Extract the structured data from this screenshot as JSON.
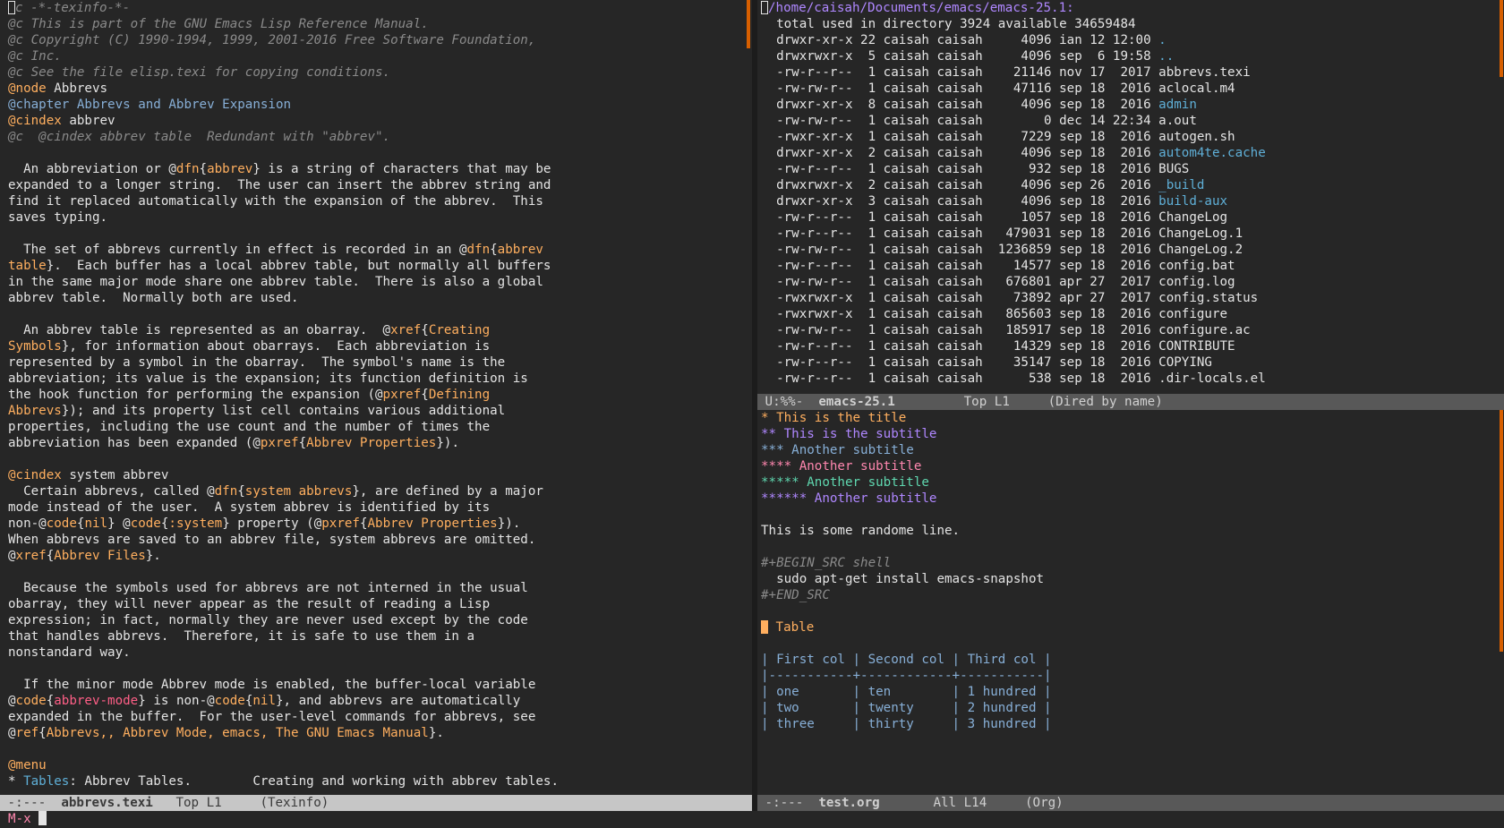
{
  "left": {
    "lines": [
      [
        {
          "t": "@c -*-texinfo-*-",
          "c": "comment",
          "cursor": true
        }
      ],
      [
        {
          "t": "@c This is part of the GNU Emacs Lisp Reference Manual.",
          "c": "comment"
        }
      ],
      [
        {
          "t": "@c Copyright (C) 1990-1994, 1999, 2001-2016 Free Software Foundation,",
          "c": "comment"
        }
      ],
      [
        {
          "t": "@c Inc.",
          "c": "comment"
        }
      ],
      [
        {
          "t": "@c See the file elisp.texi for copying conditions.",
          "c": "comment"
        }
      ],
      [
        {
          "t": "@",
          "c": "at"
        },
        {
          "t": "node",
          "c": "cmd"
        },
        {
          "t": " Abbrevs",
          "c": "plain"
        }
      ],
      [
        {
          "t": "@chapter Abbrevs and Abbrev Expansion",
          "c": "chap"
        }
      ],
      [
        {
          "t": "@",
          "c": "at"
        },
        {
          "t": "cindex",
          "c": "cmd"
        },
        {
          "t": " abbrev",
          "c": "plain"
        }
      ],
      [
        {
          "t": "@c  @cindex abbrev table  Redundant with \"abbrev\".",
          "c": "comment"
        }
      ],
      [
        {
          "t": "",
          "c": "plain"
        }
      ],
      [
        {
          "t": "  An abbreviation or @",
          "c": "plain"
        },
        {
          "t": "dfn",
          "c": "cmd"
        },
        {
          "t": "{",
          "c": "plain"
        },
        {
          "t": "abbrev",
          "c": "arg"
        },
        {
          "t": "} is a string of characters that may be",
          "c": "plain"
        }
      ],
      [
        {
          "t": "expanded to a longer string.  The user can insert the abbrev string and",
          "c": "plain"
        }
      ],
      [
        {
          "t": "find it replaced automatically with the expansion of the abbrev.  This",
          "c": "plain"
        }
      ],
      [
        {
          "t": "saves typing.",
          "c": "plain"
        }
      ],
      [
        {
          "t": "",
          "c": "plain"
        }
      ],
      [
        {
          "t": "  The set of abbrevs currently in effect is recorded in an @",
          "c": "plain"
        },
        {
          "t": "dfn",
          "c": "cmd"
        },
        {
          "t": "{",
          "c": "plain"
        },
        {
          "t": "abbrev",
          "c": "arg"
        }
      ],
      [
        {
          "t": "table",
          "c": "arg"
        },
        {
          "t": "}.  Each buffer has a local abbrev table, but normally all buffers",
          "c": "plain"
        }
      ],
      [
        {
          "t": "in the same major mode share one abbrev table.  There is also a global",
          "c": "plain"
        }
      ],
      [
        {
          "t": "abbrev table.  Normally both are used.",
          "c": "plain"
        }
      ],
      [
        {
          "t": "",
          "c": "plain"
        }
      ],
      [
        {
          "t": "  An abbrev table is represented as an obarray.  @",
          "c": "plain"
        },
        {
          "t": "xref",
          "c": "cmd"
        },
        {
          "t": "{",
          "c": "plain"
        },
        {
          "t": "Creating",
          "c": "arg"
        }
      ],
      [
        {
          "t": "Symbols",
          "c": "arg"
        },
        {
          "t": "}, for information about obarrays.  Each abbreviation is",
          "c": "plain"
        }
      ],
      [
        {
          "t": "represented by a symbol in the obarray.  The symbol's name is the",
          "c": "plain"
        }
      ],
      [
        {
          "t": "abbreviation; its value is the expansion; its function definition is",
          "c": "plain"
        }
      ],
      [
        {
          "t": "the hook function for performing the expansion (@",
          "c": "plain"
        },
        {
          "t": "pxref",
          "c": "cmd"
        },
        {
          "t": "{",
          "c": "plain"
        },
        {
          "t": "Defining",
          "c": "arg"
        }
      ],
      [
        {
          "t": "Abbrevs",
          "c": "arg"
        },
        {
          "t": "}); and its property list cell contains various additional",
          "c": "plain"
        }
      ],
      [
        {
          "t": "properties, including the use count and the number of times the",
          "c": "plain"
        }
      ],
      [
        {
          "t": "abbreviation has been expanded (@",
          "c": "plain"
        },
        {
          "t": "pxref",
          "c": "cmd"
        },
        {
          "t": "{",
          "c": "plain"
        },
        {
          "t": "Abbrev Properties",
          "c": "arg"
        },
        {
          "t": "}).",
          "c": "plain"
        }
      ],
      [
        {
          "t": "",
          "c": "plain"
        }
      ],
      [
        {
          "t": "@",
          "c": "at"
        },
        {
          "t": "cindex",
          "c": "cmd"
        },
        {
          "t": " system abbrev",
          "c": "plain"
        }
      ],
      [
        {
          "t": "  Certain abbrevs, called @",
          "c": "plain"
        },
        {
          "t": "dfn",
          "c": "cmd"
        },
        {
          "t": "{",
          "c": "plain"
        },
        {
          "t": "system abbrevs",
          "c": "arg"
        },
        {
          "t": "}, are defined by a major",
          "c": "plain"
        }
      ],
      [
        {
          "t": "mode instead of the user.  A system abbrev is identified by its",
          "c": "plain"
        }
      ],
      [
        {
          "t": "non-@",
          "c": "plain"
        },
        {
          "t": "code",
          "c": "cmd"
        },
        {
          "t": "{",
          "c": "plain"
        },
        {
          "t": "nil",
          "c": "arg"
        },
        {
          "t": "} @",
          "c": "plain"
        },
        {
          "t": "code",
          "c": "cmd"
        },
        {
          "t": "{",
          "c": "plain"
        },
        {
          "t": ":system",
          "c": "arg"
        },
        {
          "t": "} property (@",
          "c": "plain"
        },
        {
          "t": "pxref",
          "c": "cmd"
        },
        {
          "t": "{",
          "c": "plain"
        },
        {
          "t": "Abbrev Properties",
          "c": "arg"
        },
        {
          "t": "}).",
          "c": "plain"
        }
      ],
      [
        {
          "t": "When abbrevs are saved to an abbrev file, system abbrevs are omitted.",
          "c": "plain"
        }
      ],
      [
        {
          "t": "@",
          "c": "plain"
        },
        {
          "t": "xref",
          "c": "cmd"
        },
        {
          "t": "{",
          "c": "plain"
        },
        {
          "t": "Abbrev Files",
          "c": "arg"
        },
        {
          "t": "}.",
          "c": "plain"
        }
      ],
      [
        {
          "t": "",
          "c": "plain"
        }
      ],
      [
        {
          "t": "  Because the symbols used for abbrevs are not interned in the usual",
          "c": "plain"
        }
      ],
      [
        {
          "t": "obarray, they will never appear as the result of reading a Lisp",
          "c": "plain"
        }
      ],
      [
        {
          "t": "expression; in fact, normally they are never used except by the code",
          "c": "plain"
        }
      ],
      [
        {
          "t": "that handles abbrevs.  Therefore, it is safe to use them in a",
          "c": "plain"
        }
      ],
      [
        {
          "t": "nonstandard way.",
          "c": "plain"
        }
      ],
      [
        {
          "t": "",
          "c": "plain"
        }
      ],
      [
        {
          "t": "  If the minor mode Abbrev mode is enabled, the buffer-local variable",
          "c": "plain"
        }
      ],
      [
        {
          "t": "@",
          "c": "plain"
        },
        {
          "t": "code",
          "c": "cmd"
        },
        {
          "t": "{",
          "c": "plain"
        },
        {
          "t": "abbrev-mode",
          "c": "pink"
        },
        {
          "t": "} is non-@",
          "c": "plain"
        },
        {
          "t": "code",
          "c": "cmd"
        },
        {
          "t": "{",
          "c": "plain"
        },
        {
          "t": "nil",
          "c": "arg"
        },
        {
          "t": "}, and abbrevs are automatically",
          "c": "plain"
        }
      ],
      [
        {
          "t": "expanded in the buffer.  For the user-level commands for abbrevs, see",
          "c": "plain"
        }
      ],
      [
        {
          "t": "@",
          "c": "plain"
        },
        {
          "t": "ref",
          "c": "cmd"
        },
        {
          "t": "{",
          "c": "plain"
        },
        {
          "t": "Abbrevs,, Abbrev Mode, emacs, The GNU Emacs Manual",
          "c": "arg"
        },
        {
          "t": "}.",
          "c": "plain"
        }
      ],
      [
        {
          "t": "",
          "c": "plain"
        }
      ],
      [
        {
          "t": "@",
          "c": "at"
        },
        {
          "t": "menu",
          "c": "cmd"
        }
      ],
      [
        {
          "t": "* ",
          "c": "plain"
        },
        {
          "t": "Tables",
          "c": "blue"
        },
        {
          "t": ": Abbrev Tables.        Creating and working with abbrev tables.",
          "c": "plain"
        }
      ]
    ]
  },
  "dired": {
    "header": "/home/caisah/Documents/emacs/emacs-25.1:",
    "total": "total used in directory 3924 available 34659484",
    "entries": [
      {
        "perm": "drwxr-xr-x",
        "n": "22",
        "size": "4096",
        "date": "ian 12 12:00",
        "name": ".",
        "dir": true
      },
      {
        "perm": "drwxrwxr-x",
        "n": " 5",
        "size": "4096",
        "date": "sep  6 19:58",
        "name": "..",
        "dir": true
      },
      {
        "perm": "-rw-r--r--",
        "n": " 1",
        "size": "21146",
        "date": "nov 17  2017",
        "name": "abbrevs.texi",
        "dir": false
      },
      {
        "perm": "-rw-rw-r--",
        "n": " 1",
        "size": "47116",
        "date": "sep 18  2016",
        "name": "aclocal.m4",
        "dir": false
      },
      {
        "perm": "drwxr-xr-x",
        "n": " 8",
        "size": "4096",
        "date": "sep 18  2016",
        "name": "admin",
        "dir": true
      },
      {
        "perm": "-rw-rw-r--",
        "n": " 1",
        "size": "0",
        "date": "dec 14 22:34",
        "name": "a.out",
        "dir": false
      },
      {
        "perm": "-rwxr-xr-x",
        "n": " 1",
        "size": "7229",
        "date": "sep 18  2016",
        "name": "autogen.sh",
        "dir": false
      },
      {
        "perm": "drwxr-xr-x",
        "n": " 2",
        "size": "4096",
        "date": "sep 18  2016",
        "name": "autom4te.cache",
        "dir": true
      },
      {
        "perm": "-rw-r--r--",
        "n": " 1",
        "size": "932",
        "date": "sep 18  2016",
        "name": "BUGS",
        "dir": false
      },
      {
        "perm": "drwxrwxr-x",
        "n": " 2",
        "size": "4096",
        "date": "sep 26  2016",
        "name": "_build",
        "dir": true
      },
      {
        "perm": "drwxr-xr-x",
        "n": " 3",
        "size": "4096",
        "date": "sep 18  2016",
        "name": "build-aux",
        "dir": true
      },
      {
        "perm": "-rw-r--r--",
        "n": " 1",
        "size": "1057",
        "date": "sep 18  2016",
        "name": "ChangeLog",
        "dir": false
      },
      {
        "perm": "-rw-r--r--",
        "n": " 1",
        "size": "479031",
        "date": "sep 18  2016",
        "name": "ChangeLog.1",
        "dir": false
      },
      {
        "perm": "-rw-rw-r--",
        "n": " 1",
        "size": "1236859",
        "date": "sep 18  2016",
        "name": "ChangeLog.2",
        "dir": false
      },
      {
        "perm": "-rw-r--r--",
        "n": " 1",
        "size": "14577",
        "date": "sep 18  2016",
        "name": "config.bat",
        "dir": false
      },
      {
        "perm": "-rw-rw-r--",
        "n": " 1",
        "size": "676801",
        "date": "apr 27  2017",
        "name": "config.log",
        "dir": false
      },
      {
        "perm": "-rwxrwxr-x",
        "n": " 1",
        "size": "73892",
        "date": "apr 27  2017",
        "name": "config.status",
        "dir": false
      },
      {
        "perm": "-rwxrwxr-x",
        "n": " 1",
        "size": "865603",
        "date": "sep 18  2016",
        "name": "configure",
        "dir": false
      },
      {
        "perm": "-rw-rw-r--",
        "n": " 1",
        "size": "185917",
        "date": "sep 18  2016",
        "name": "configure.ac",
        "dir": false
      },
      {
        "perm": "-rw-r--r--",
        "n": " 1",
        "size": "14329",
        "date": "sep 18  2016",
        "name": "CONTRIBUTE",
        "dir": false
      },
      {
        "perm": "-rw-r--r--",
        "n": " 1",
        "size": "35147",
        "date": "sep 18  2016",
        "name": "COPYING",
        "dir": false
      },
      {
        "perm": "-rw-r--r--",
        "n": " 1",
        "size": "538",
        "date": "sep 18  2016",
        "name": ".dir-locals.el",
        "dir": false
      }
    ],
    "owner": "caisah",
    "group": "caisah"
  },
  "org": {
    "lines": [
      [
        {
          "t": "* This is the title",
          "c": "h1"
        }
      ],
      [
        {
          "t": "** This is the subtitle",
          "c": "h2"
        }
      ],
      [
        {
          "t": "*** Another subtitle",
          "c": "h3"
        }
      ],
      [
        {
          "t": "**** Another subtitle",
          "c": "h4"
        }
      ],
      [
        {
          "t": "***** Another subtitle",
          "c": "h5"
        }
      ],
      [
        {
          "t": "****** Another subtitle",
          "c": "h6"
        }
      ],
      [
        {
          "t": "",
          "c": "plain"
        }
      ],
      [
        {
          "t": "This is some randome line.",
          "c": "plain"
        }
      ],
      [
        {
          "t": "",
          "c": "plain"
        }
      ],
      [
        {
          "t": "#+BEGIN_SRC shell",
          "c": "src"
        }
      ],
      [
        {
          "t": "  sudo apt-get install emacs-snapshot",
          "c": "plain"
        }
      ],
      [
        {
          "t": "#+END_SRC",
          "c": "src"
        }
      ],
      [
        {
          "t": "",
          "c": "plain"
        }
      ],
      [
        {
          "t": "*",
          "c": "h1",
          "cursor": true
        },
        {
          "t": " Table",
          "c": "h1"
        }
      ],
      [
        {
          "t": "",
          "c": "plain"
        }
      ],
      [
        {
          "t": "| First col | Second col | Third col |",
          "c": "table"
        }
      ],
      [
        {
          "t": "|-----------+------------+-----------|",
          "c": "table"
        }
      ],
      [
        {
          "t": "| one       | ten        | 1 hundred |",
          "c": "table"
        }
      ],
      [
        {
          "t": "| two       | twenty     | 2 hundred |",
          "c": "table"
        }
      ],
      [
        {
          "t": "| three     | thirty     | 3 hundred |",
          "c": "table"
        }
      ]
    ]
  },
  "modelines": {
    "left": {
      "status": " -:---  ",
      "buffer": "abbrevs.texi",
      "pos": "   Top L1     ",
      "mode": "(Texinfo)"
    },
    "dired": {
      "status": " U:%%-  ",
      "buffer": "emacs-25.1",
      "pos": "         Top L1     ",
      "mode": "(Dired by name)"
    },
    "org": {
      "status": " -:---  ",
      "buffer": "test.org",
      "pos": "       All L14     ",
      "mode": "(Org)"
    }
  },
  "minibuffer": {
    "prompt": "M-x "
  },
  "colors": {
    "background": "#262626",
    "foreground": "#e4e4e4",
    "comment": "#8a8a8a",
    "keyword": "#ffaf5f",
    "link": "#5fafd7"
  }
}
